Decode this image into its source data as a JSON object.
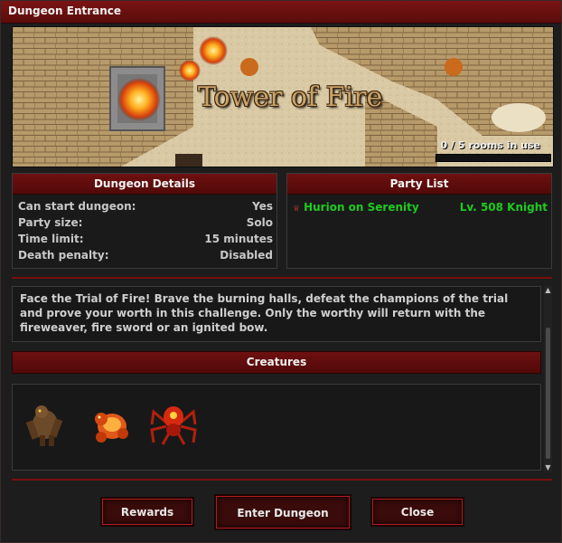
{
  "window": {
    "title": "Dungeon Entrance"
  },
  "banner": {
    "dungeon_name": "Tower of Fire",
    "rooms_text": "0 / 5 rooms in use",
    "rooms_used": 0,
    "rooms_total": 5
  },
  "details": {
    "title": "Dungeon Details",
    "rows": [
      {
        "label": "Can start dungeon:",
        "value": "Yes"
      },
      {
        "label": "Party size:",
        "value": "Solo"
      },
      {
        "label": "Time limit:",
        "value": "15 minutes"
      },
      {
        "label": "Death penalty:",
        "value": "Disabled"
      }
    ]
  },
  "party": {
    "title": "Party List",
    "members": [
      {
        "name": "Hurion on Serenity",
        "info": "Lv. 508 Knight",
        "color": "#1ecb1e",
        "icon": "crown-icon"
      }
    ]
  },
  "description": "Face the Trial of Fire! Brave the burning halls, defeat the champions of the trial and prove your worth in this challenge. Only the worthy will return with the fireweaver, fire sword or an ignited bow.",
  "creatures": {
    "title": "Creatures",
    "items": [
      {
        "icon": "brown-golem-creature-icon"
      },
      {
        "icon": "fire-golem-creature-icon"
      },
      {
        "icon": "fire-spider-creature-icon"
      }
    ]
  },
  "buttons": {
    "rewards": "Rewards",
    "enter": "Enter Dungeon",
    "close": "Close"
  },
  "colors": {
    "accent": "#6e1010",
    "party_text": "#1ecb1e"
  }
}
